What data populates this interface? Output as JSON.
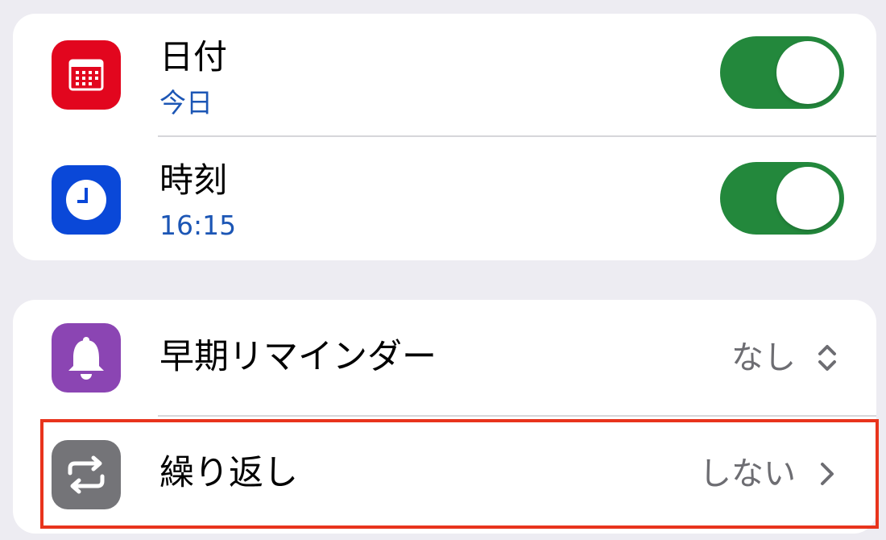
{
  "colors": {
    "background": "#EDECF2",
    "toggle_on": "#23883C",
    "subtitle_blue": "#1C56B5",
    "secondary_text": "#6D6D72",
    "highlight_red": "#E8341C"
  },
  "date_time_group": {
    "date": {
      "icon": "calendar-icon",
      "icon_color": "#E2061E",
      "label": "日付",
      "value": "今日",
      "enabled": true
    },
    "time": {
      "icon": "clock-icon",
      "icon_color": "#0A48D8",
      "label": "時刻",
      "value": "16:15",
      "enabled": true
    }
  },
  "options_group": {
    "early_reminder": {
      "icon": "bell-icon",
      "icon_color": "#8B45B3",
      "label": "早期リマインダー",
      "value": "なし",
      "accessory": "chevron-up-down-icon"
    },
    "repeat": {
      "icon": "repeat-icon",
      "icon_color": "#747478",
      "label": "繰り返し",
      "value": "しない",
      "accessory": "chevron-right-icon",
      "highlighted": true
    }
  }
}
